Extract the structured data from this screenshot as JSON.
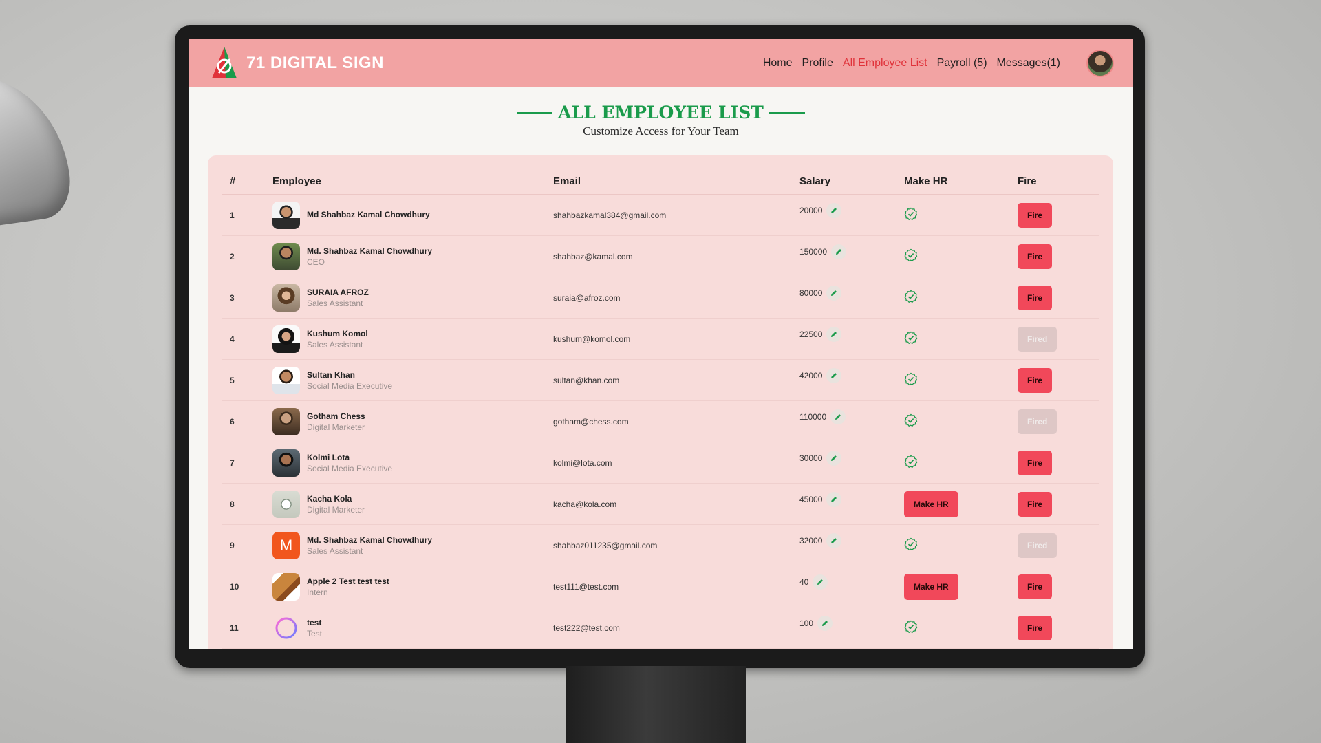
{
  "brand": {
    "name": "71 DIGITAL SIGN",
    "logo_colors": [
      "#e0323a",
      "#1a9b4b"
    ]
  },
  "nav": {
    "links": [
      {
        "label": "Home",
        "active": false
      },
      {
        "label": "Profile",
        "active": false
      },
      {
        "label": "All Employee List",
        "active": true
      },
      {
        "label": "Payroll (5)",
        "active": false
      },
      {
        "label": "Messages(1)",
        "active": false
      }
    ]
  },
  "page": {
    "title": "ALL EMPLOYEE LIST",
    "subtitle": "Customize Access for Your Team"
  },
  "table": {
    "headers": [
      "#",
      "Employee",
      "Email",
      "Salary",
      "Make HR",
      "Fire"
    ],
    "rows": [
      {
        "num": "1",
        "name": "Md Shahbaz Kamal Chowdhury",
        "role": "",
        "email": "shahbazkamal384@gmail.com",
        "salary": "20000",
        "hr": "check",
        "fire": "Fire",
        "avatar": "photo-man-beard"
      },
      {
        "num": "2",
        "name": "Md. Shahbaz Kamal Chowdhury",
        "role": "CEO",
        "email": "shahbaz@kamal.com",
        "salary": "150000",
        "hr": "check",
        "fire": "Fire",
        "avatar": "photo-man-outdoor"
      },
      {
        "num": "3",
        "name": "SURAIA AFROZ",
        "role": "Sales Assistant",
        "email": "suraia@afroz.com",
        "salary": "80000",
        "hr": "check",
        "fire": "Fire",
        "avatar": "photo-woman-curly"
      },
      {
        "num": "4",
        "name": "Kushum Komol",
        "role": "Sales Assistant",
        "email": "kushum@komol.com",
        "salary": "22500",
        "hr": "check",
        "fire": "Fired",
        "avatar": "photo-woman-dark"
      },
      {
        "num": "5",
        "name": "Sultan Khan",
        "role": "Social Media Executive",
        "email": "sultan@khan.com",
        "salary": "42000",
        "hr": "check",
        "fire": "Fire",
        "avatar": "photo-man-shirt"
      },
      {
        "num": "6",
        "name": "Gotham Chess",
        "role": "Digital Marketer",
        "email": "gotham@chess.com",
        "salary": "110000",
        "hr": "check",
        "fire": "Fired",
        "avatar": "photo-man-chess"
      },
      {
        "num": "7",
        "name": "Kolmi Lota",
        "role": "Social Media Executive",
        "email": "kolmi@lota.com",
        "salary": "30000",
        "hr": "check",
        "fire": "Fire",
        "avatar": "photo-man-beard2"
      },
      {
        "num": "8",
        "name": "Kacha Kola",
        "role": "Digital Marketer",
        "email": "kacha@kola.com",
        "salary": "45000",
        "hr": "Make HR",
        "fire": "Fire",
        "avatar": "photo-placeholder"
      },
      {
        "num": "9",
        "name": "Md. Shahbaz Kamal Chowdhury",
        "role": "Sales Assistant",
        "email": "shahbaz011235@gmail.com",
        "salary": "32000",
        "hr": "check",
        "fire": "Fired",
        "avatar": "letter-m"
      },
      {
        "num": "10",
        "name": "Apple 2 Test test test",
        "role": "Intern",
        "email": "test111@test.com",
        "salary": "40",
        "hr": "Make HR",
        "fire": "Fire",
        "avatar": "photo-box"
      },
      {
        "num": "11",
        "name": "test",
        "role": "Test",
        "email": "test222@test.com",
        "salary": "100",
        "hr": "check",
        "fire": "Fire",
        "avatar": "ring"
      }
    ],
    "letter_avatar": "M"
  },
  "colors": {
    "navbar_bg": "#f2a3a3",
    "accent_red": "#e0323a",
    "accent_green": "#1a9b4b",
    "card_bg": "#f8dcda",
    "fire_button": "#f1485a",
    "fired_button": "#dec7c6"
  }
}
